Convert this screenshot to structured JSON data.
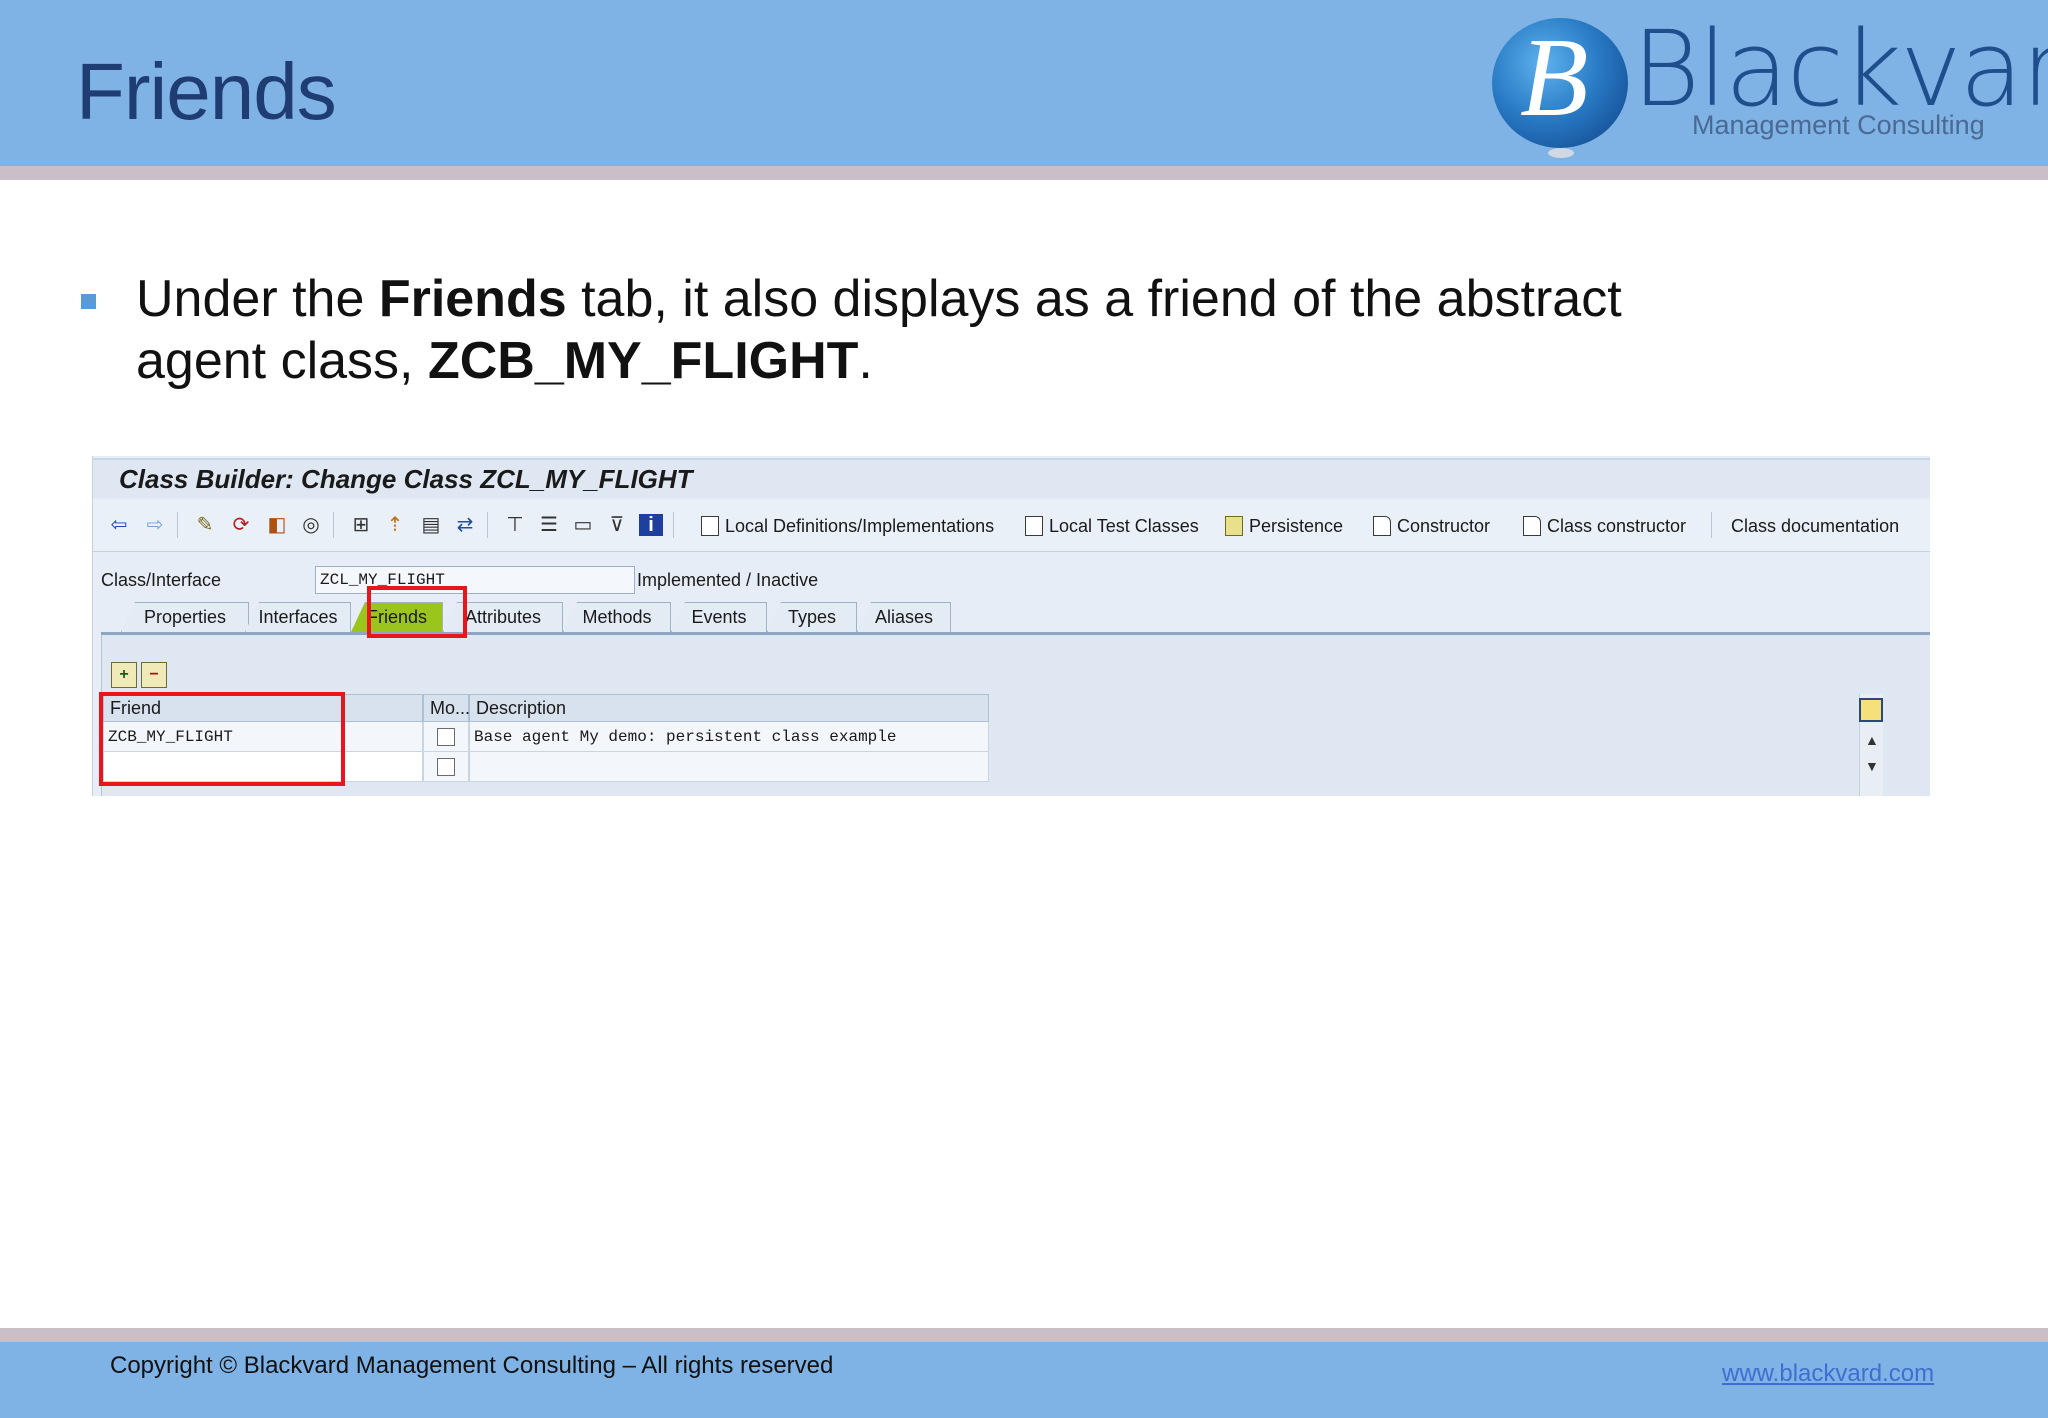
{
  "slide": {
    "title": "Friends",
    "logo": {
      "initial": "B",
      "name": "Blackvard",
      "subtitle": "Management Consulting"
    },
    "bullet": {
      "part1": "Under the ",
      "bold1": "Friends",
      "part2": " tab, it also displays as a friend of the abstract agent class, ",
      "bold2": "ZCB_MY_FLIGHT",
      "part3": "."
    },
    "footer": {
      "copyright": "Copyright © Blackvard Management Consulting – All rights reserved",
      "link": "www.blackvard.com"
    }
  },
  "sap": {
    "window_title": "Class Builder: Change Class ZCL_MY_FLIGHT",
    "toolbar": {
      "icons": [
        "back-arrow-icon",
        "forward-arrow-icon",
        "pen-icon",
        "switch-icon",
        "object-list-icon",
        "spiral-icon",
        "hierarchy-icon",
        "pin-icon",
        "display-icon",
        "navigate-icon",
        "tree-icon",
        "stack-icon",
        "list-icon",
        "filter-icon",
        "info-icon"
      ],
      "buttons": [
        {
          "label": "Local Definitions/Implementations"
        },
        {
          "label": "Local Test Classes"
        },
        {
          "label": "Persistence"
        },
        {
          "label": "Constructor"
        },
        {
          "label": "Class constructor"
        },
        {
          "label": "Class documentation"
        }
      ]
    },
    "class_field": {
      "label": "Class/Interface",
      "value": "ZCL_MY_FLIGHT",
      "status": "Implemented / Inactive"
    },
    "tabs": [
      {
        "label": "Properties",
        "active": false
      },
      {
        "label": "Interfaces",
        "active": false
      },
      {
        "label": "Friends",
        "active": true
      },
      {
        "label": "Attributes",
        "active": false
      },
      {
        "label": "Methods",
        "active": false
      },
      {
        "label": "Events",
        "active": false
      },
      {
        "label": "Types",
        "active": false
      },
      {
        "label": "Aliases",
        "active": false
      }
    ],
    "table": {
      "headers": {
        "friend": "Friend",
        "modeled": "Mo...",
        "description": "Description"
      },
      "rows": [
        {
          "friend": "ZCB_MY_FLIGHT",
          "modeled": false,
          "description": "Base agent My demo: persistent class example"
        },
        {
          "friend": "",
          "modeled": false,
          "description": ""
        }
      ]
    },
    "highlight_color": "#e8161b",
    "active_tab_color": "#9bc51c"
  }
}
